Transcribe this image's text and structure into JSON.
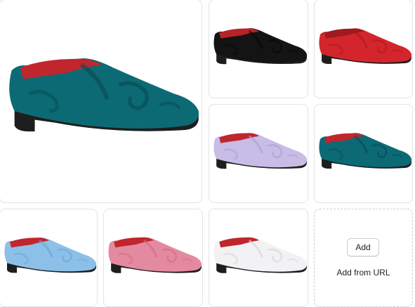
{
  "gallery": {
    "items": [
      {
        "name": "Teal velvet paisley loafer",
        "upper": "#0c6a74",
        "upper_dark": "#084a52",
        "lining": "#c0262d",
        "sole": "#1e1e1e"
      },
      {
        "name": "Black velvet paisley loafer",
        "upper": "#141414",
        "upper_dark": "#050505",
        "lining": "#b8232a",
        "sole": "#1e1e1e"
      },
      {
        "name": "Red velvet paisley loafer",
        "upper": "#d3252b",
        "upper_dark": "#a91b20",
        "lining": "#9e1a1f",
        "sole": "#1e1e1e"
      },
      {
        "name": "Lavender velvet paisley loafer",
        "upper": "#c7bde6",
        "upper_dark": "#a99cd0",
        "lining": "#c0262d",
        "sole": "#1e1e1e"
      },
      {
        "name": "Teal velvet paisley loafer",
        "upper": "#0c6a74",
        "upper_dark": "#084a52",
        "lining": "#c0262d",
        "sole": "#1e1e1e"
      },
      {
        "name": "Light blue velvet paisley loafer",
        "upper": "#8cc0e8",
        "upper_dark": "#6aa3d0",
        "lining": "#c0262d",
        "sole": "#1e1e1e"
      },
      {
        "name": "Pink velvet paisley loafer",
        "upper": "#e48aa0",
        "upper_dark": "#c96c83",
        "lining": "#c0262d",
        "sole": "#1e1e1e"
      },
      {
        "name": "White velvet paisley loafer",
        "upper": "#f2f2f4",
        "upper_dark": "#d4d4d8",
        "lining": "#c0262d",
        "sole": "#1e1e1e"
      }
    ]
  },
  "uploader": {
    "add_label": "Add",
    "add_from_url_label": "Add from URL"
  }
}
